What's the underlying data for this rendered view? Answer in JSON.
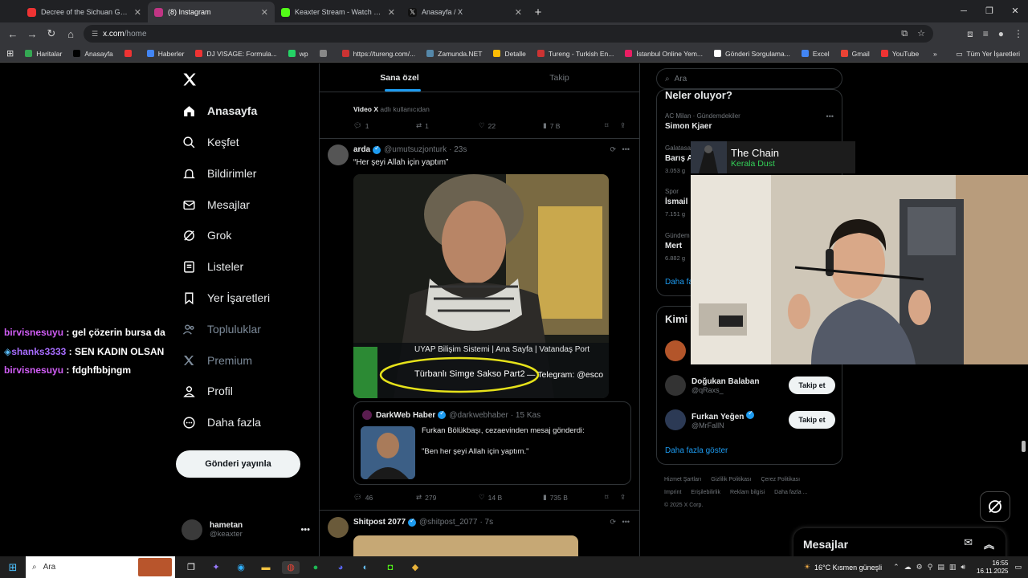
{
  "browser": {
    "tabs": [
      {
        "title": "Decree of the Sichuan General",
        "color": "#e33",
        "active": false
      },
      {
        "title": "(8) Instagram",
        "color": "#c13584",
        "active": true
      },
      {
        "title": "Keaxter Stream - Watch Live on",
        "color": "#53fc18",
        "active": false
      },
      {
        "title": "Anasayfa / X",
        "color": "#000",
        "active": false
      }
    ],
    "url_host": "x.com",
    "url_path": "/home",
    "bookmarks": [
      {
        "label": "Haritalar",
        "color": "#34a853"
      },
      {
        "label": "Anasayfa",
        "color": "#000"
      },
      {
        "label": "",
        "color": "#e33"
      },
      {
        "label": "Haberler",
        "color": "#4285f4"
      },
      {
        "label": "DJ VISAGE: Formula...",
        "color": "#e33"
      },
      {
        "label": "wp",
        "color": "#25d366"
      },
      {
        "label": "",
        "color": "#888"
      },
      {
        "label": "https://tureng.com/...",
        "color": "#c33"
      },
      {
        "label": "Zamunda.NET",
        "color": "#58a"
      },
      {
        "label": "Detalle",
        "color": "#fbbc05"
      },
      {
        "label": "Tureng - Turkish En...",
        "color": "#c33"
      },
      {
        "label": "İstanbul Online Yem...",
        "color": "#e91e63"
      },
      {
        "label": "Gönderi Sorgulama...",
        "color": "#fff"
      },
      {
        "label": "Excel",
        "color": "#4285f4"
      },
      {
        "label": "Gmail",
        "color": "#ea4335"
      },
      {
        "label": "YouTube",
        "color": "#e33"
      }
    ],
    "all_bookmarks": "Tüm Yer İşaretleri"
  },
  "nav": {
    "items": [
      {
        "label": "Anasayfa",
        "icon": "home-icon"
      },
      {
        "label": "Keşfet",
        "icon": "search-icon"
      },
      {
        "label": "Bildirimler",
        "icon": "bell-icon"
      },
      {
        "label": "Mesajlar",
        "icon": "mail-icon"
      },
      {
        "label": "Grok",
        "icon": "grok-icon"
      },
      {
        "label": "Listeler",
        "icon": "list-icon"
      },
      {
        "label": "Yer İşaretleri",
        "icon": "bookmark-icon"
      },
      {
        "label": "Topluluklar",
        "icon": "people-icon"
      },
      {
        "label": "Premium",
        "icon": "x-icon"
      },
      {
        "label": "Profil",
        "icon": "user-icon"
      },
      {
        "label": "Daha fazla",
        "icon": "more-icon"
      }
    ],
    "post_button": "Gönderi yayınla",
    "account": {
      "name": "hametan",
      "handle": "@keaxter"
    }
  },
  "chat": [
    {
      "user": "birvisnesuyu",
      "message": "gel çözerin bursa da"
    },
    {
      "user": "shanks3333",
      "message": "SEN KADIN OLSAN"
    },
    {
      "user": "birvisnesuyu",
      "message": "fdghfbbjngm"
    }
  ],
  "feed": {
    "tabs": [
      "Sana özel",
      "Takip"
    ],
    "prev_note_user": "Video X",
    "prev_note_text": "adlı kullanıcıdan",
    "prev_actions": {
      "replies": "1",
      "reposts": "1",
      "likes": "22",
      "views": "7 B"
    },
    "tweet1": {
      "name": "arda",
      "handle": "@umutsuzjonturk",
      "time": "· 23s",
      "text": "“Her şeyi Allah için yaptım”",
      "media_caption_top": "UYAP Bilişim Sistemi | Ana Sayfa | Vatandaş Port",
      "media_caption": "Türbanlı Simge Sakso Part2",
      "media_caption_right": "— Telegram: @esco",
      "quote": {
        "name": "DarkWeb Haber",
        "handle": "@darkwebhaber",
        "time": "· 15 Kas",
        "line1": "Furkan Bölükbaşı, cezaevinden mesaj gönderdi:",
        "line2": "\"Ben her şeyi Allah için yaptım.\""
      },
      "actions": {
        "replies": "46",
        "reposts": "279",
        "likes": "14 B",
        "views": "735 B"
      }
    },
    "tweet2": {
      "name": "Shitpost 2077",
      "handle": "@shitpost_2077",
      "time": "· 7s"
    }
  },
  "right": {
    "search_placeholder": "Ara",
    "trends_title": "Neler oluyor?",
    "trends": [
      {
        "context": "AC Milan · Gündemdekiler",
        "name": "Simon Kjaer",
        "count": ""
      },
      {
        "context": "Galatasaray",
        "name": "Barış A",
        "count": "3.053 g"
      },
      {
        "context": "Spor",
        "name": "İsmail",
        "count": "7.151 g"
      },
      {
        "context": "Gündem",
        "name": "Mert",
        "count": "6.882 g"
      }
    ],
    "trends_more": "Daha fa",
    "who_title": "Kimi",
    "who": [
      {
        "name": "Doğukan Balaban",
        "handle": "@qRaxs_",
        "verified": false
      },
      {
        "name": "Furkan Yeğen",
        "handle": "@MrFallN",
        "verified": true
      }
    ],
    "follow_label": "Takip et",
    "who_more": "Daha fazla göster",
    "footer": [
      "Hizmet Şartları",
      "Gizlilik Politikası",
      "Çerez Politikası",
      "Imprint",
      "Erişilebilirlik",
      "Reklam bilgisi",
      "Daha fazla ...",
      "© 2025 X Corp."
    ]
  },
  "music": {
    "song": "The Chain",
    "artist": "Kerala Dust"
  },
  "messages_dock": "Mesajlar",
  "taskbar": {
    "search": "Ara",
    "weather": "16°C  Kısmen güneşli",
    "time": "16:55",
    "date": "16.11.2025"
  }
}
